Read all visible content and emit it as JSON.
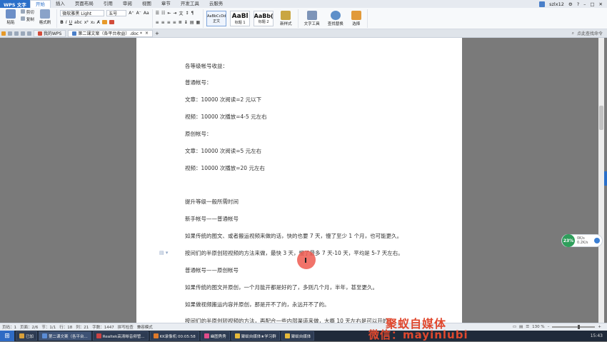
{
  "app": {
    "name": "WPS 文字",
    "user": "szlx12"
  },
  "menu": [
    "开始",
    "插入",
    "页面布局",
    "引用",
    "审阅",
    "视图",
    "章节",
    "开发工具",
    "云服务"
  ],
  "ribbon": {
    "cut": "剪切",
    "copy": "复制",
    "format_painter": "格式刷",
    "paste": "粘贴",
    "font_name": "微软雅黑 Light",
    "font_size": "五号",
    "styles": [
      {
        "preview": "AaBbCcDd",
        "label": "正文"
      },
      {
        "preview": "AaBl",
        "label": "标题 1"
      },
      {
        "preview": "AaBb(",
        "label": "标题 2"
      }
    ],
    "new_style": "新样式",
    "text_tools": "文字工具",
    "find_replace": "查找替换",
    "select": "选择"
  },
  "tabs": [
    {
      "label": "我的WPS"
    },
    {
      "label": "第二课文案（各平台收益）.doc *"
    }
  ],
  "tabbar_right": "点此查找命令",
  "document": {
    "lines": [
      "各等级帐号收益：",
      "普通帐号：",
      "文章：10000 次阅读=2 元以下",
      "视频：10000 次播放=4-5 元左右",
      "原创帐号：",
      "文章：10000 次阅读=5 元左右",
      "视频：10000 次播放=20 元左右",
      "",
      "提升等级一般所需时间",
      "新手帐号——普通帐号",
      "如果传统的图文、或者搬运视频来做的话，快的也要 7 天，慢了至少 1 个月，也可能更久。",
      "按间们的半原创短视频的方法来做，最快 3 天，慢了最多 7 天-10 天，平均是 5-7 天左右。",
      "普通帐号——原创帐号",
      "如果传统的图文并原创，一个月能开都是好的了，多则几个月，半年，甚至更久。",
      "如果做视频搬运内容并原创，那是开不了的，永远开不了的。",
      "按间们的半原创短视频的方法，再配合一些内部渠道来做，大概 10 天左右是可以开的"
    ]
  },
  "status": {
    "page": "页码：1",
    "pages": "页面：2/6",
    "section": "节：1/1",
    "row": "行：18",
    "col": "列：21",
    "chars": "字数：1447",
    "spell": "拼写检查",
    "mode": "兼容模式",
    "zoom": "130 %"
  },
  "speed_widget": {
    "percent": "23%",
    "up": "0K/s",
    "down": "0.2K/s"
  },
  "watermark": {
    "line1": "聚蚁自媒体",
    "line2": "微信：mayinlubi"
  },
  "taskbar": {
    "items": [
      "已加",
      "第二课文案（各平台...",
      "Realtek高清晰音频管...",
      "KK录像机 00:05:58",
      "幽图秀秀",
      "聚蚁自媒体★学习群",
      "聚蚁自媒体"
    ],
    "time": "15:43"
  }
}
